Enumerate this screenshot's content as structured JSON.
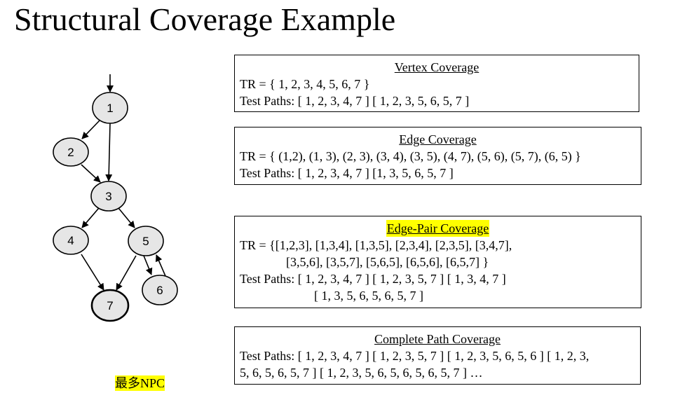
{
  "title": "Structural Coverage Example",
  "graph": {
    "nodes": [
      "1",
      "2",
      "3",
      "4",
      "5",
      "6",
      "7"
    ]
  },
  "boxes": {
    "vertex": {
      "heading": "Vertex Coverage",
      "tr": "TR = { 1, 2, 3, 4, 5, 6, 7 }",
      "paths": "Test Paths: [ 1, 2, 3, 4, 7 ] [ 1, 2, 3, 5, 6, 5, 7 ]"
    },
    "edge": {
      "heading": "Edge Coverage",
      "tr": "TR = { (1,2), (1, 3), (2, 3), (3, 4), (3, 5), (4, 7), (5, 6), (5, 7), (6, 5) }",
      "paths": "Test Paths: [ 1, 2, 3, 4, 7 ] [1, 3, 5, 6, 5, 7 ]"
    },
    "edge_pair": {
      "heading": "Edge-Pair Coverage",
      "tr_line1": "TR = {[1,2,3], [1,3,4], [1,3,5], [2,3,4], [2,3,5], [3,4,7],",
      "tr_line2": "[3,5,6], [3,5,7], [5,6,5], [6,5,6], [6,5,7] }",
      "paths_line1": "Test Paths: [ 1, 2, 3, 4, 7 ] [ 1, 2, 3, 5, 7 ] [ 1, 3, 4, 7 ]",
      "paths_line2": "[ 1, 3, 5, 6, 5, 6, 5, 7 ]"
    },
    "complete_path": {
      "heading": "Complete Path Coverage",
      "paths_line1": "Test Paths: [ 1, 2, 3, 4, 7 ] [ 1, 2, 3, 5, 7 ] [ 1, 2, 3, 5, 6, 5, 6 ] [ 1, 2, 3,",
      "paths_line2": "5, 6, 5, 6, 5, 7 ] [ 1, 2, 3, 5, 6, 5, 6, 5, 6, 5, 7 ] …"
    }
  },
  "note": "最多NPC",
  "colors": {
    "highlight": "#ffff00",
    "node_fill": "#e6e6e6",
    "stroke": "#000000"
  }
}
